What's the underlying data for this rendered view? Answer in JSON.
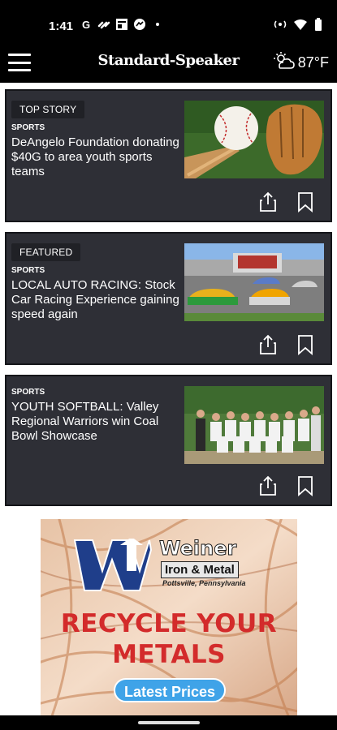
{
  "status_bar": {
    "time": "1:41",
    "icons": [
      "google-icon",
      "link-icon",
      "news-icon",
      "messenger-icon",
      "dot"
    ],
    "right_icons": [
      "hotspot-icon",
      "wifi-icon",
      "battery-icon"
    ]
  },
  "header": {
    "masthead": "Standard-Speaker",
    "weather_icon": "partly-cloudy-icon",
    "temperature": "87°F"
  },
  "cards": [
    {
      "badge": "TOP STORY",
      "section": "SPORTS",
      "headline": "DeAngelo Foundation donating $40G to area youth sports teams",
      "image": "baseball-equipment"
    },
    {
      "badge": "FEATURED",
      "section": "SPORTS",
      "headline": "LOCAL AUTO RACING: Stock Car Racing Experience gaining speed again",
      "image": "stock-cars-on-track"
    },
    {
      "badge": "",
      "section": "SPORTS",
      "headline": "YOUTH SOFTBALL: Valley Regional Warriors win Coal Bowl Showcase",
      "image": "softball-team-photo"
    }
  ],
  "ad": {
    "brand": "Weiner",
    "brand_sub": "Iron & Metal",
    "location": "Pottsville, Pennsylvania",
    "headline_line1": "RECYCLE YOUR",
    "headline_line2": "METALS",
    "button": "Latest Prices"
  },
  "colors": {
    "card_bg": "#2e2f36",
    "badge_bg": "#202126",
    "ad_red": "#d32b2b",
    "ad_button": "#3fa3e8"
  }
}
